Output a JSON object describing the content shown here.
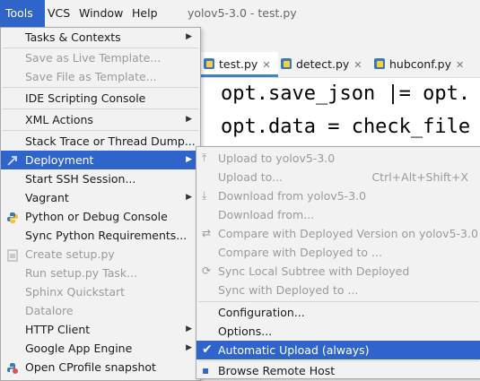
{
  "menubar": {
    "tools": "Tools",
    "vcs": "VCS",
    "window": "Window",
    "help": "Help",
    "title": "yolov5-3.0 - test.py"
  },
  "editor": {
    "tabs": [
      "test.py",
      "detect.py",
      "hubconf.py"
    ],
    "code_lines": [
      "opt.save_json |= opt.",
      "opt.data = check_file"
    ]
  },
  "tools_menu": {
    "items": [
      "Tasks & Contexts",
      "Save as Live Template...",
      "Save File as Template...",
      "IDE Scripting Console",
      "XML Actions",
      "Stack Trace or Thread Dump...",
      "Deployment",
      "Start SSH Session...",
      "Vagrant",
      "Python or Debug Console",
      "Sync Python Requirements...",
      "Create setup.py",
      "Run setup.py Task...",
      "Sphinx Quickstart",
      "Datalore",
      "HTTP Client",
      "Google App Engine",
      "Open CProfile snapshot"
    ]
  },
  "deployment_menu": {
    "items": [
      "Upload to yolov5-3.0",
      "Upload to...",
      "Download from yolov5-3.0",
      "Download from...",
      "Compare with Deployed Version on yolov5-3.0",
      "Compare with Deployed to ...",
      "Sync Local Subtree with Deployed",
      "Sync with Deployed to ...",
      "Configuration...",
      "Options...",
      "Automatic Upload (always)",
      "Browse Remote Host"
    ],
    "upload_to_shortcut": "Ctrl+Alt+Shift+X"
  },
  "colors": {
    "highlight": "#2f65ca",
    "menu_bg": "#f2f2f2",
    "disabled_text": "#9a9a9a"
  }
}
